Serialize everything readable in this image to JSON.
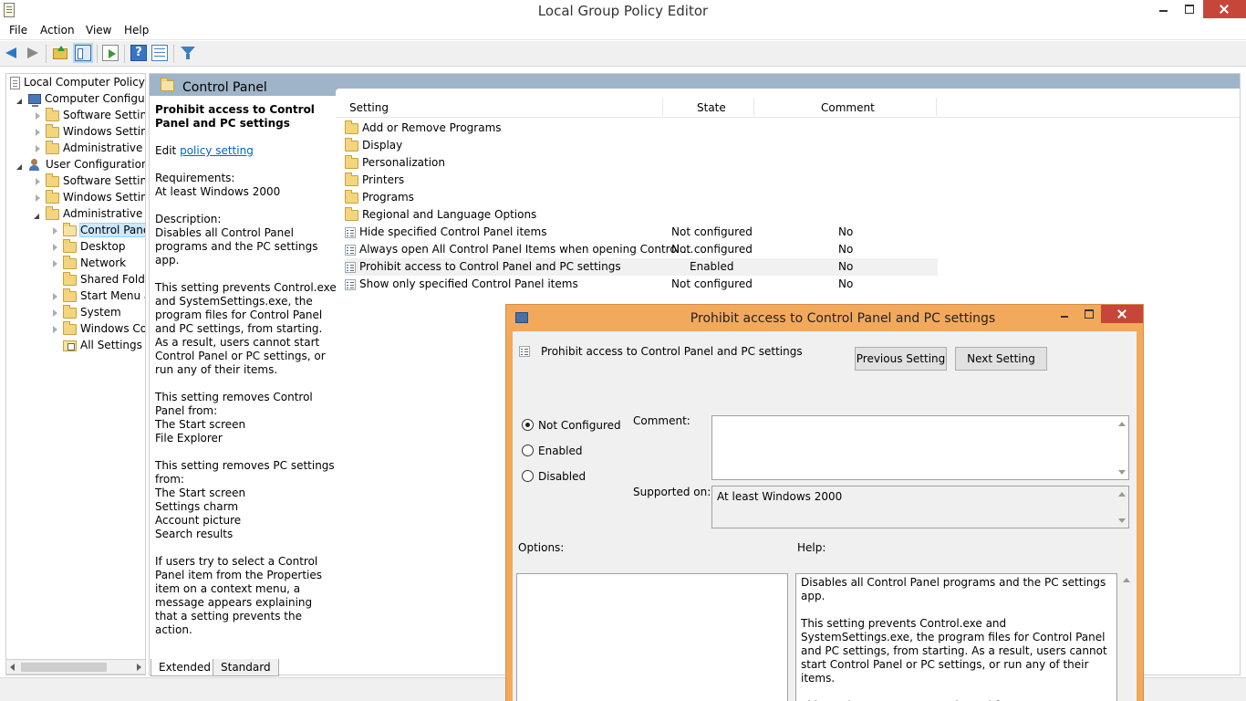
{
  "window": {
    "title": "Local Group Policy Editor"
  },
  "menu": [
    "File",
    "Action",
    "View",
    "Help"
  ],
  "toolbar": {
    "icons": [
      "back-arrow-icon",
      "forward-arrow-icon",
      "up-folder-icon",
      "show-hide-pane-icon",
      "export-list-icon",
      "help-icon",
      "properties-icon",
      "filter-icon"
    ],
    "help_glyph": "?"
  },
  "tree": {
    "items": [
      {
        "label": "Local Computer Policy",
        "icon": "policy-doc-icon",
        "level": 0,
        "expand": "none"
      },
      {
        "label": "Computer Configura",
        "icon": "computer-icon",
        "level": 1,
        "expand": "expanded"
      },
      {
        "label": "Software Settings",
        "icon": "folder-icon",
        "level": 2,
        "expand": "collapsed"
      },
      {
        "label": "Windows Setting",
        "icon": "folder-icon",
        "level": 2,
        "expand": "collapsed"
      },
      {
        "label": "Administrative Te",
        "icon": "folder-icon",
        "level": 2,
        "expand": "collapsed"
      },
      {
        "label": "User Configuration",
        "icon": "user-icon",
        "level": 1,
        "expand": "expanded"
      },
      {
        "label": "Software Settings",
        "icon": "folder-icon",
        "level": 2,
        "expand": "collapsed"
      },
      {
        "label": "Windows Setting",
        "icon": "folder-icon",
        "level": 2,
        "expand": "collapsed"
      },
      {
        "label": "Administrative Te",
        "icon": "folder-icon",
        "level": 2,
        "expand": "expanded"
      },
      {
        "label": "Control Panel",
        "icon": "folder-open-icon",
        "level": 3,
        "expand": "collapsed",
        "selected": true
      },
      {
        "label": "Desktop",
        "icon": "folder-icon",
        "level": 3,
        "expand": "collapsed"
      },
      {
        "label": "Network",
        "icon": "folder-icon",
        "level": 3,
        "expand": "collapsed"
      },
      {
        "label": "Shared Folder",
        "icon": "folder-icon",
        "level": 3,
        "expand": "none"
      },
      {
        "label": "Start Menu ar",
        "icon": "folder-icon",
        "level": 3,
        "expand": "collapsed"
      },
      {
        "label": "System",
        "icon": "folder-icon",
        "level": 3,
        "expand": "collapsed"
      },
      {
        "label": "Windows Cor",
        "icon": "folder-icon",
        "level": 3,
        "expand": "collapsed"
      },
      {
        "label": "All Settings",
        "icon": "all-settings-icon",
        "level": 3,
        "expand": "none"
      }
    ]
  },
  "pane": {
    "header_title": "Control Panel",
    "desc_title": "Prohibit access to Control Panel and PC settings",
    "edit_prefix": "Edit",
    "edit_link": "policy setting",
    "req_label": "Requirements:",
    "req_value": "At least Windows 2000",
    "desc_label": "Description:",
    "desc_p1": "Disables all Control Panel programs and the PC settings app.",
    "desc_p2": "This setting prevents Control.exe and SystemSettings.exe, the program files for Control Panel and PC settings, from starting. As a result, users cannot start Control Panel or PC settings, or run any of their items.",
    "desc_p3_label": "This setting removes Control Panel from:",
    "desc_p3_items": [
      "The Start screen",
      "File Explorer"
    ],
    "desc_p4_label": "This setting removes PC settings from:",
    "desc_p4_items": [
      "The Start screen",
      "Settings charm",
      "Account picture",
      "Search results"
    ],
    "desc_p5": "If users try to select a Control Panel item from the Properties item on a context menu, a message appears explaining that a setting prevents the action."
  },
  "list": {
    "columns": {
      "setting": "Setting",
      "state": "State",
      "comment": "Comment"
    },
    "rows": [
      {
        "name": "Add or Remove Programs",
        "type": "folder",
        "state": "",
        "comment": ""
      },
      {
        "name": "Display",
        "type": "folder",
        "state": "",
        "comment": ""
      },
      {
        "name": "Personalization",
        "type": "folder",
        "state": "",
        "comment": ""
      },
      {
        "name": "Printers",
        "type": "folder",
        "state": "",
        "comment": ""
      },
      {
        "name": "Programs",
        "type": "folder",
        "state": "",
        "comment": ""
      },
      {
        "name": "Regional and Language Options",
        "type": "folder",
        "state": "",
        "comment": ""
      },
      {
        "name": "Hide specified Control Panel items",
        "type": "setting",
        "state": "Not configured",
        "comment": "No"
      },
      {
        "name": "Always open All Control Panel Items when opening Control ...",
        "type": "setting",
        "state": "Not configured",
        "comment": "No"
      },
      {
        "name": "Prohibit access to Control Panel and PC settings",
        "type": "setting",
        "state": "Enabled",
        "comment": "No",
        "highlighted": true
      },
      {
        "name": "Show only specified Control Panel items",
        "type": "setting",
        "state": "Not configured",
        "comment": "No"
      }
    ]
  },
  "tabs": [
    "Extended",
    "Standard"
  ],
  "dialog": {
    "title": "Prohibit access to Control Panel and PC settings",
    "policy_name": "Prohibit access to Control Panel and PC settings",
    "prev_button": "Previous Setting",
    "next_button": "Next Setting",
    "radios": [
      {
        "label": "Not Configured",
        "checked": true
      },
      {
        "label": "Enabled",
        "checked": false
      },
      {
        "label": "Disabled",
        "checked": false
      }
    ],
    "comment_label": "Comment:",
    "comment_value": "",
    "supported_label": "Supported on:",
    "supported_value": "At least Windows 2000",
    "options_label": "Options:",
    "help_label": "Help:",
    "help_text": "Disables all Control Panel programs and the PC settings app.\n\nThis setting prevents Control.exe and SystemSettings.exe, the program files for Control Panel and PC settings, from starting. As a result, users cannot start Control Panel or PC settings, or run any of their items.\n\nThis setting removes Control Panel from:\nThe Start screen\nFile Explorer\n\nThis setting removes PC settings from:"
  },
  "colors": {
    "dialog_frame": "#f3a95c",
    "pane_header": "#9fb4c8",
    "close_button": "#c7463a",
    "link": "#0066cc"
  }
}
